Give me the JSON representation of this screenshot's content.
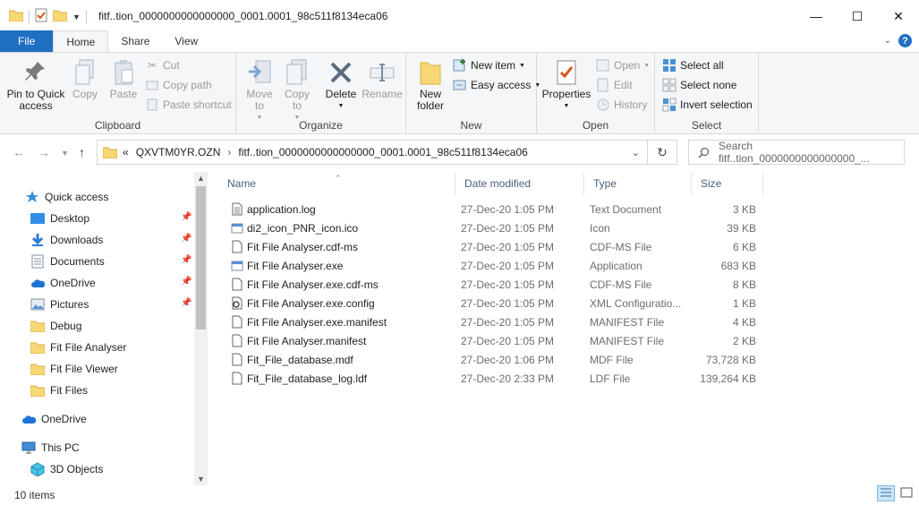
{
  "window": {
    "title": "fitf..tion_0000000000000000_0001.0001_98c511f8134eca06",
    "controls": [
      "minimize",
      "maximize",
      "close"
    ]
  },
  "ribbon_tabs": [
    "File",
    "Home",
    "Share",
    "View"
  ],
  "ribbon": {
    "clipboard": {
      "label": "Clipboard",
      "pin": "Pin to Quick access",
      "copy": "Copy",
      "paste": "Paste",
      "cut": "Cut",
      "copy_path": "Copy path",
      "paste_shortcut": "Paste shortcut"
    },
    "organize": {
      "label": "Organize",
      "move_to": "Move to",
      "copy_to": "Copy to",
      "delete": "Delete",
      "rename": "Rename"
    },
    "new": {
      "label": "New",
      "new_folder": "New folder",
      "new_item": "New item",
      "easy_access": "Easy access"
    },
    "open": {
      "label": "Open",
      "properties": "Properties",
      "open": "Open",
      "edit": "Edit",
      "history": "History"
    },
    "select": {
      "label": "Select",
      "select_all": "Select all",
      "select_none": "Select none",
      "invert_selection": "Invert selection"
    }
  },
  "address": {
    "prefix": "«",
    "parent": "QXVTM0YR.OZN",
    "current": "fitf..tion_0000000000000000_0001.0001_98c511f8134eca06"
  },
  "search": {
    "placeholder": "Search fitf..tion_0000000000000000_..."
  },
  "nav": {
    "quick_access": "Quick access",
    "items": [
      {
        "label": "Desktop",
        "pinned": true
      },
      {
        "label": "Downloads",
        "pinned": true
      },
      {
        "label": "Documents",
        "pinned": true
      },
      {
        "label": "OneDrive",
        "pinned": true
      },
      {
        "label": "Pictures",
        "pinned": true
      },
      {
        "label": "Debug",
        "pinned": false
      },
      {
        "label": "Fit File Analyser",
        "pinned": false
      },
      {
        "label": "Fit File Viewer",
        "pinned": false
      },
      {
        "label": "Fit Files",
        "pinned": false
      }
    ],
    "onedrive": "OneDrive",
    "this_pc": "This PC",
    "objects_3d": "3D Objects"
  },
  "columns": {
    "name": "Name",
    "date": "Date modified",
    "type": "Type",
    "size": "Size"
  },
  "files": [
    {
      "name": "application.log",
      "date": "27-Dec-20 1:05 PM",
      "type": "Text Document",
      "size": "3 KB",
      "icon": "text-file"
    },
    {
      "name": "di2_icon_PNR_icon.ico",
      "date": "27-Dec-20 1:05 PM",
      "type": "Icon",
      "size": "39 KB",
      "icon": "app-file"
    },
    {
      "name": "Fit File Analyser.cdf-ms",
      "date": "27-Dec-20 1:05 PM",
      "type": "CDF-MS File",
      "size": "6 KB",
      "icon": "blank-file"
    },
    {
      "name": "Fit File Analyser.exe",
      "date": "27-Dec-20 1:05 PM",
      "type": "Application",
      "size": "683 KB",
      "icon": "app-file"
    },
    {
      "name": "Fit File Analyser.exe.cdf-ms",
      "date": "27-Dec-20 1:05 PM",
      "type": "CDF-MS File",
      "size": "8 KB",
      "icon": "blank-file"
    },
    {
      "name": "Fit File Analyser.exe.config",
      "date": "27-Dec-20 1:05 PM",
      "type": "XML Configuratio...",
      "size": "1 KB",
      "icon": "config-file"
    },
    {
      "name": "Fit File Analyser.exe.manifest",
      "date": "27-Dec-20 1:05 PM",
      "type": "MANIFEST File",
      "size": "4 KB",
      "icon": "blank-file"
    },
    {
      "name": "Fit File Analyser.manifest",
      "date": "27-Dec-20 1:05 PM",
      "type": "MANIFEST File",
      "size": "2 KB",
      "icon": "blank-file"
    },
    {
      "name": "Fit_File_database.mdf",
      "date": "27-Dec-20 1:06 PM",
      "type": "MDF File",
      "size": "73,728 KB",
      "icon": "blank-file"
    },
    {
      "name": "Fit_File_database_log.ldf",
      "date": "27-Dec-20 2:33 PM",
      "type": "LDF File",
      "size": "139,264 KB",
      "icon": "blank-file"
    }
  ],
  "status": {
    "item_count": "10 items"
  },
  "colors": {
    "accent": "#1f6fc5",
    "folder": "#f8d775",
    "header_text": "#4c607a"
  }
}
